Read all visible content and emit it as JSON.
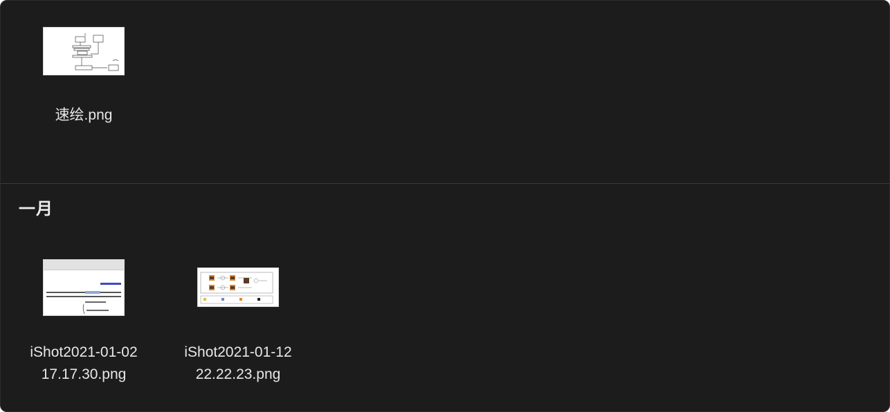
{
  "sections": [
    {
      "title": "",
      "files": [
        {
          "name_lines": [
            "速绘.png"
          ],
          "thumb": "flowchart-sketch"
        }
      ]
    },
    {
      "title": "一月",
      "files": [
        {
          "name_lines": [
            "iShot2021-01-02",
            "17.17.30.png"
          ],
          "thumb": "math-document"
        },
        {
          "name_lines": [
            "iShot2021-01-12",
            "22.22.23.png"
          ],
          "thumb": "network-diagram"
        }
      ]
    }
  ],
  "colors": {
    "background": "#1c1c1c",
    "text": "#e8e8e8",
    "divider": "#3a3a3a",
    "link_blue": "#3b4cc0",
    "highlight": "#8fa8d8",
    "orange": "#e08a2c",
    "dark_brown": "#5a3a2a"
  }
}
